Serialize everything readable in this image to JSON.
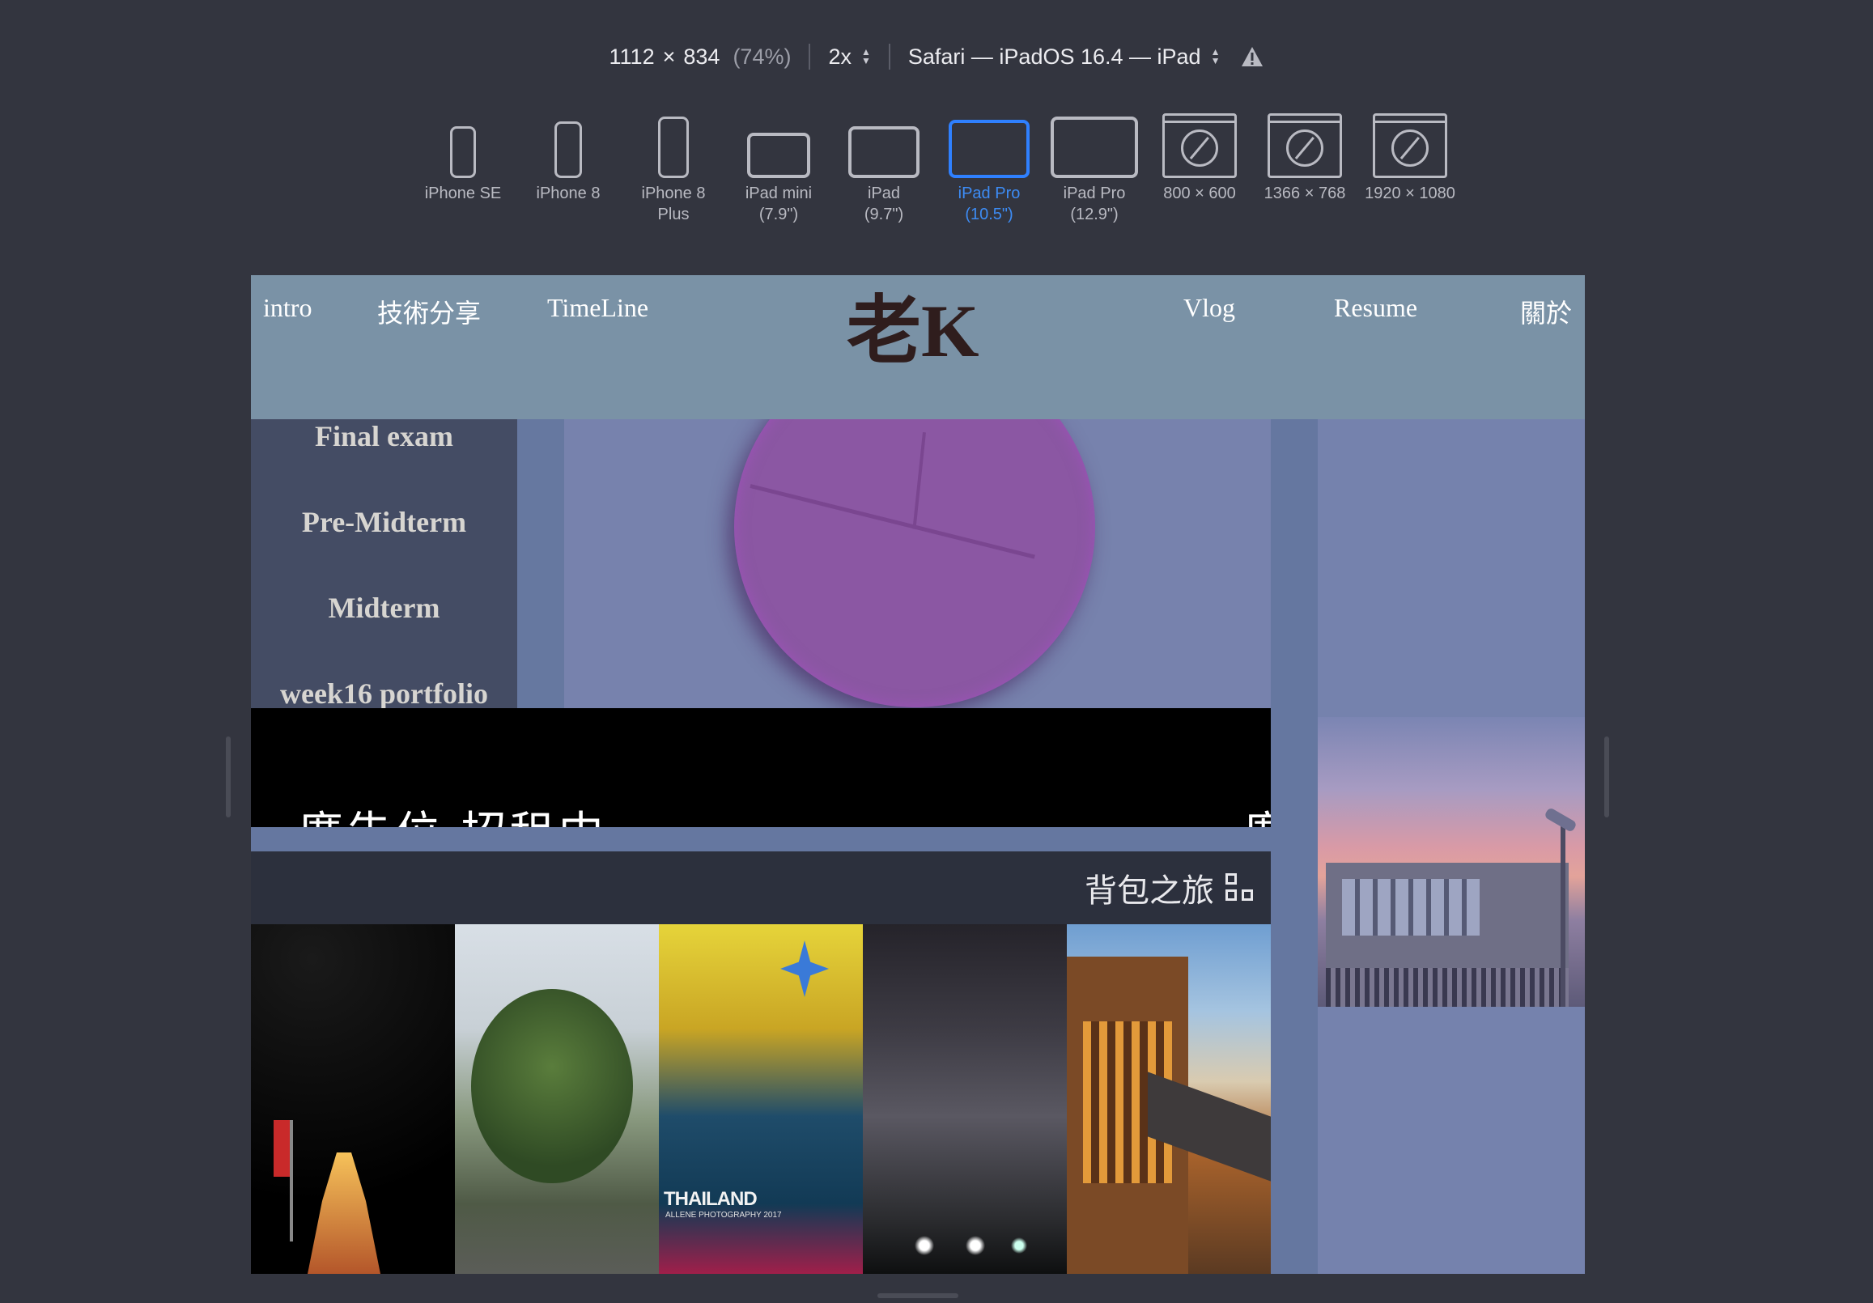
{
  "toolbar": {
    "width": "1112",
    "times": "×",
    "height": "834",
    "zoom": "(74%)",
    "scale": "2x",
    "browser": "Safari — iPadOS 16.4 — iPad"
  },
  "devices": [
    {
      "label": "iPhone SE",
      "icon": "phone-icon"
    },
    {
      "label": "iPhone 8",
      "icon": "phone-icon"
    },
    {
      "label": "iPhone 8\nPlus",
      "icon": "phone-icon"
    },
    {
      "label": "iPad mini\n(7.9\")",
      "icon": "tablet-icon"
    },
    {
      "label": "iPad\n(9.7\")",
      "icon": "tablet-icon"
    },
    {
      "label": "iPad Pro\n(10.5\")",
      "icon": "tablet-icon",
      "active": true
    },
    {
      "label": "iPad Pro\n(12.9\")",
      "icon": "tablet-icon"
    },
    {
      "label": "800 × 600",
      "icon": "browser-icon"
    },
    {
      "label": "1366 × 768",
      "icon": "browser-icon"
    },
    {
      "label": "1920 × 1080",
      "icon": "browser-icon"
    }
  ],
  "site": {
    "logo": "老K",
    "nav": {
      "intro": "intro",
      "tech": "技術分享",
      "timeline": "TimeLine",
      "vlog": "Vlog",
      "resume": "Resume",
      "about": "關於"
    },
    "sidebar": [
      "Final exam",
      "Pre-Midterm",
      "Midterm",
      "week16 portfolio"
    ],
    "marquee": {
      "text": "廣告位 招租中",
      "tail": "廣"
    },
    "section_title": "背包之旅",
    "photo_label": "THAILAND",
    "photo_sublabel": "ALLENE PHOTOGRAPHY 2017"
  },
  "colors": {
    "accent": "#2f80ff",
    "page_bg": "#33353f",
    "header": "#7a92a6",
    "sidebar": "#444c64",
    "clock": "#8b57a3"
  }
}
